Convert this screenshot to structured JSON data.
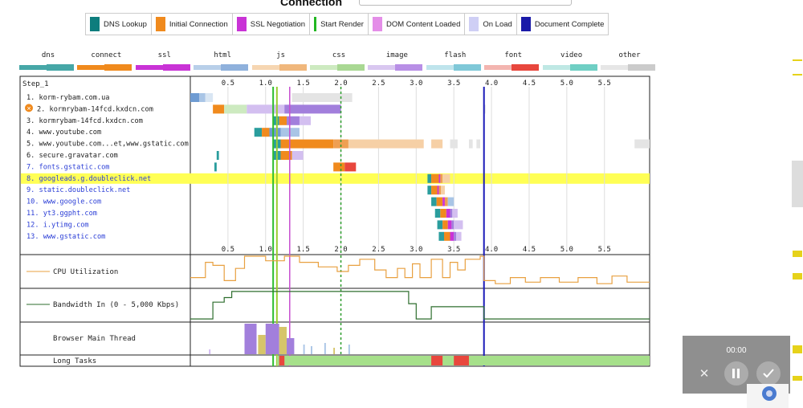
{
  "header": {
    "title": "Connection"
  },
  "legend_main": [
    {
      "label": "DNS Lookup",
      "color": "#0d7d7d"
    },
    {
      "label": "Initial Connection",
      "color": "#f08a1d"
    },
    {
      "label": "SSL Negotiation",
      "color": "#c933d6"
    },
    {
      "label": "Start Render",
      "color": "#22b722"
    },
    {
      "label": "DOM Content Loaded",
      "color": "#e48ee8"
    },
    {
      "label": "On Load",
      "color": "#cfcff5"
    },
    {
      "label": "Document Complete",
      "color": "#1a1aa8"
    }
  ],
  "legend_types": [
    {
      "label": "dns",
      "light": "#46a7a7",
      "dark": "#46a7a7"
    },
    {
      "label": "connect",
      "light": "#f08a1d",
      "dark": "#f08a1d"
    },
    {
      "label": "ssl",
      "light": "#c933d6",
      "dark": "#c933d6"
    },
    {
      "label": "html",
      "light": "#b8cfe9",
      "dark": "#8fb1dc"
    },
    {
      "label": "js",
      "light": "#f6d6b2",
      "dark": "#f0b77c"
    },
    {
      "label": "css",
      "light": "#cdeac0",
      "dark": "#a9d893"
    },
    {
      "label": "image",
      "light": "#d9c7f0",
      "dark": "#b88fe6"
    },
    {
      "label": "flash",
      "light": "#bfe4ec",
      "dark": "#7fc8d8"
    },
    {
      "label": "font",
      "light": "#f3b5b0",
      "dark": "#e8473d"
    },
    {
      "label": "video",
      "light": "#bfe8e4",
      "dark": "#6fcfc4"
    },
    {
      "label": "other",
      "light": "#e6e6e6",
      "dark": "#cbcbcb"
    }
  ],
  "waterfall": {
    "step_label": "Step_1",
    "axis_ticks": [
      "0.5",
      "1.0",
      "1.5",
      "2.0",
      "2.5",
      "3.0",
      "3.5",
      "4.0",
      "4.5",
      "5.0",
      "5.5"
    ],
    "x_max": 6.1,
    "markers": [
      {
        "name": "start-render",
        "t": 1.1,
        "color": "#2ebd2e"
      },
      {
        "name": "start-render-2",
        "t": 1.15,
        "color": "#9acd32"
      },
      {
        "name": "dom-content-loaded",
        "t": 1.32,
        "color": "#c74fd0"
      },
      {
        "name": "on-load",
        "t": 2.0,
        "color": "#2c9c2c",
        "dashed": true
      },
      {
        "name": "document-complete",
        "t": 3.9,
        "color": "#1a1ab8"
      }
    ],
    "requests": [
      {
        "label": "1. korm-rybam.com.ua",
        "link": false,
        "error": false,
        "highlight": false,
        "segs": [
          [
            0.0,
            0.12,
            "html-dk"
          ],
          [
            0.12,
            0.2,
            "html"
          ],
          [
            0.2,
            0.3,
            "html-lt"
          ],
          [
            1.35,
            2.15,
            "other"
          ]
        ]
      },
      {
        "label": "2. kormrybam-14fcd.kxdcn.com",
        "link": false,
        "error": true,
        "highlight": false,
        "segs": [
          [
            0.3,
            0.45,
            "connect"
          ],
          [
            0.45,
            0.75,
            "css"
          ],
          [
            0.75,
            1.25,
            "image"
          ],
          [
            1.25,
            2.0,
            "image-dk"
          ],
          [
            3.9,
            3.92,
            "other"
          ]
        ]
      },
      {
        "label": "3. kormrybam-14fcd.kxdcn.com",
        "link": false,
        "error": false,
        "highlight": false,
        "segs": [
          [
            1.1,
            1.18,
            "dns"
          ],
          [
            1.18,
            1.28,
            "connect"
          ],
          [
            1.28,
            1.45,
            "image-dk"
          ],
          [
            1.45,
            1.6,
            "image"
          ]
        ]
      },
      {
        "label": "4. www.youtube.com",
        "link": false,
        "error": false,
        "highlight": false,
        "segs": [
          [
            0.85,
            0.95,
            "dns"
          ],
          [
            0.95,
            1.05,
            "connect"
          ],
          [
            1.05,
            1.2,
            "html-dk"
          ],
          [
            1.2,
            1.45,
            "html"
          ]
        ]
      },
      {
        "label": "5. www.youtube.com...et,www.gstatic.com",
        "link": false,
        "error": false,
        "highlight": false,
        "segs": [
          [
            1.1,
            1.2,
            "dns"
          ],
          [
            1.2,
            1.9,
            "connect"
          ],
          [
            1.9,
            2.1,
            "js-dk"
          ],
          [
            2.1,
            3.1,
            "js"
          ],
          [
            3.2,
            3.35,
            "js"
          ],
          [
            3.45,
            3.55,
            "other"
          ],
          [
            3.7,
            3.75,
            "other"
          ],
          [
            3.8,
            3.85,
            "other"
          ],
          [
            5.9,
            6.1,
            "other"
          ]
        ]
      },
      {
        "label": "6. secure.gravatar.com",
        "link": false,
        "error": false,
        "highlight": false,
        "segs": [
          [
            0.35,
            0.38,
            "dns"
          ],
          [
            1.1,
            1.2,
            "dns"
          ],
          [
            1.2,
            1.35,
            "connect"
          ],
          [
            1.35,
            1.5,
            "image"
          ]
        ]
      },
      {
        "label": "7. fonts.gstatic.com",
        "link": true,
        "error": false,
        "highlight": false,
        "segs": [
          [
            0.32,
            0.35,
            "dns"
          ],
          [
            1.9,
            2.05,
            "connect"
          ],
          [
            2.05,
            2.2,
            "font"
          ]
        ]
      },
      {
        "label": "8. googleads.g.doubleclick.net",
        "link": true,
        "error": false,
        "highlight": true,
        "segs": [
          [
            3.15,
            3.2,
            "dns"
          ],
          [
            3.2,
            3.3,
            "connect"
          ],
          [
            3.3,
            3.32,
            "ssl"
          ],
          [
            3.32,
            3.35,
            "js-dk"
          ],
          [
            3.35,
            3.45,
            "js"
          ]
        ]
      },
      {
        "label": "9. static.doubleclick.net",
        "link": true,
        "error": false,
        "highlight": false,
        "segs": [
          [
            3.15,
            3.2,
            "dns"
          ],
          [
            3.2,
            3.28,
            "connect"
          ],
          [
            3.28,
            3.3,
            "ssl"
          ],
          [
            3.3,
            3.33,
            "js-dk"
          ],
          [
            3.33,
            3.38,
            "js"
          ]
        ]
      },
      {
        "label": "10. www.google.com",
        "link": true,
        "error": false,
        "highlight": false,
        "segs": [
          [
            3.2,
            3.27,
            "dns"
          ],
          [
            3.27,
            3.35,
            "connect"
          ],
          [
            3.35,
            3.38,
            "ssl"
          ],
          [
            3.38,
            3.42,
            "js-dk"
          ],
          [
            3.42,
            3.5,
            "html"
          ]
        ]
      },
      {
        "label": "11. yt3.ggpht.com",
        "link": true,
        "error": false,
        "highlight": false,
        "segs": [
          [
            3.25,
            3.32,
            "dns"
          ],
          [
            3.32,
            3.4,
            "connect"
          ],
          [
            3.4,
            3.45,
            "ssl"
          ],
          [
            3.45,
            3.48,
            "image-dk"
          ],
          [
            3.48,
            3.55,
            "image"
          ]
        ]
      },
      {
        "label": "12. i.ytimg.com",
        "link": true,
        "error": false,
        "highlight": false,
        "segs": [
          [
            3.28,
            3.35,
            "dns"
          ],
          [
            3.35,
            3.42,
            "connect"
          ],
          [
            3.42,
            3.47,
            "ssl"
          ],
          [
            3.47,
            3.5,
            "image-dk"
          ],
          [
            3.5,
            3.62,
            "image"
          ]
        ]
      },
      {
        "label": "13. www.gstatic.com",
        "link": true,
        "error": false,
        "highlight": false,
        "segs": [
          [
            3.3,
            3.37,
            "dns"
          ],
          [
            3.37,
            3.45,
            "connect"
          ],
          [
            3.45,
            3.5,
            "ssl"
          ],
          [
            3.5,
            3.53,
            "image-dk"
          ],
          [
            3.53,
            3.6,
            "image"
          ]
        ]
      }
    ]
  },
  "cpu": {
    "label": "CPU Utilization",
    "color": "#e8a040",
    "points": [
      [
        0,
        0.3
      ],
      [
        0.2,
        0.3
      ],
      [
        0.2,
        0.8
      ],
      [
        0.3,
        0.8
      ],
      [
        0.3,
        0.7
      ],
      [
        0.45,
        0.7
      ],
      [
        0.45,
        0.2
      ],
      [
        0.6,
        0.2
      ],
      [
        0.6,
        0.6
      ],
      [
        0.72,
        0.6
      ],
      [
        0.72,
        1.0
      ],
      [
        1.0,
        1.0
      ],
      [
        1.0,
        0.85
      ],
      [
        1.25,
        0.85
      ],
      [
        1.25,
        1.0
      ],
      [
        1.45,
        1.0
      ],
      [
        1.45,
        0.8
      ],
      [
        1.7,
        0.8
      ],
      [
        1.7,
        0.65
      ],
      [
        1.95,
        0.65
      ],
      [
        1.95,
        0.5
      ],
      [
        2.1,
        0.5
      ],
      [
        2.1,
        0.7
      ],
      [
        2.25,
        0.7
      ],
      [
        2.25,
        0.9
      ],
      [
        2.45,
        0.9
      ],
      [
        2.45,
        0.55
      ],
      [
        2.6,
        0.55
      ],
      [
        2.6,
        0.3
      ],
      [
        2.75,
        0.3
      ],
      [
        2.75,
        0.6
      ],
      [
        2.85,
        0.6
      ],
      [
        2.85,
        0.3
      ],
      [
        2.95,
        0.3
      ],
      [
        2.95,
        0.75
      ],
      [
        3.05,
        0.75
      ],
      [
        3.05,
        0.3
      ],
      [
        3.2,
        0.3
      ],
      [
        3.2,
        0.9
      ],
      [
        3.35,
        0.9
      ],
      [
        3.35,
        0.3
      ],
      [
        3.45,
        0.3
      ],
      [
        3.45,
        0.8
      ],
      [
        3.55,
        0.8
      ],
      [
        3.55,
        0.55
      ],
      [
        3.65,
        0.55
      ],
      [
        3.65,
        0.9
      ],
      [
        3.85,
        0.9
      ],
      [
        3.85,
        1.0
      ],
      [
        3.9,
        1.0
      ],
      [
        3.9,
        0.2
      ],
      [
        4.05,
        0.2
      ],
      [
        4.05,
        0.1
      ],
      [
        4.25,
        0.1
      ],
      [
        4.25,
        0.3
      ],
      [
        4.45,
        0.3
      ],
      [
        4.45,
        0.15
      ],
      [
        4.65,
        0.15
      ],
      [
        4.65,
        0.3
      ],
      [
        4.9,
        0.3
      ],
      [
        4.9,
        0.15
      ],
      [
        5.15,
        0.15
      ],
      [
        5.15,
        0.3
      ],
      [
        5.4,
        0.3
      ],
      [
        5.4,
        0.1
      ],
      [
        5.6,
        0.1
      ],
      [
        5.6,
        0.35
      ],
      [
        5.8,
        0.35
      ],
      [
        5.8,
        0.15
      ],
      [
        6.1,
        0.15
      ]
    ]
  },
  "bandwidth": {
    "label": "Bandwidth In (0 - 5,000 Kbps)",
    "color": "#2e6e2e",
    "points": [
      [
        0,
        0.05
      ],
      [
        0.3,
        0.05
      ],
      [
        0.3,
        0.6
      ],
      [
        0.45,
        0.6
      ],
      [
        0.45,
        0.75
      ],
      [
        0.55,
        0.75
      ],
      [
        0.55,
        0.95
      ],
      [
        2.9,
        0.95
      ],
      [
        2.9,
        0.55
      ],
      [
        3.0,
        0.55
      ],
      [
        3.0,
        0.05
      ],
      [
        3.2,
        0.05
      ],
      [
        3.2,
        0.45
      ],
      [
        3.9,
        0.45
      ],
      [
        3.9,
        0.05
      ],
      [
        6.1,
        0.05
      ]
    ]
  },
  "main_thread": {
    "label": "Browser Main Thread"
  },
  "long_tasks": {
    "label": "Long Tasks",
    "spans": [
      [
        1.15,
        6.1,
        "#a6e08a"
      ],
      [
        1.18,
        1.25,
        "#e8473d"
      ],
      [
        3.2,
        3.35,
        "#e8473d"
      ],
      [
        3.5,
        3.7,
        "#e8473d"
      ]
    ]
  },
  "video": {
    "time": "00:00"
  }
}
